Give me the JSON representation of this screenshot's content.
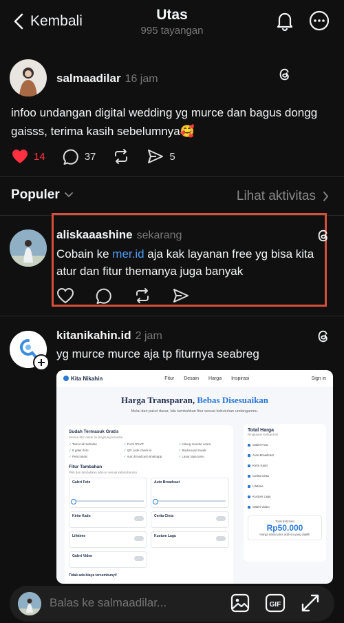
{
  "header": {
    "back_label": "Kembali",
    "title": "Utas",
    "subtitle": "995 tayangan"
  },
  "main_post": {
    "username": "salmaadilar",
    "time": "16 jam",
    "text": "infoo undangan digital  wedding yg murce dan bagus dongg gaisss, terima kasih sebelumnya🥰",
    "likes": "14",
    "comments": "37",
    "shares": "5"
  },
  "sort": {
    "label": "Populer",
    "activity_link": "Lihat aktivitas"
  },
  "reply1": {
    "username": "aliskaaashine",
    "time": "sekarang",
    "text_before": "Cobain ke ",
    "link": "mer.id",
    "text_after": " aja kak layanan free yg bisa kita atur dan fitur themanya juga banyak"
  },
  "reply2": {
    "username": "kitanikahin.id",
    "time": "2 jam",
    "text": "yg murce murce aja tp fiturnya seabreg"
  },
  "embedded": {
    "brand": "Kita Nikahin",
    "nav": [
      "Fitur",
      "Desain",
      "Harga",
      "Inspirasi"
    ],
    "sign_in": "Sign in",
    "headline_a": "Harga Transparan, ",
    "headline_b": "Bebas Disesuaikan",
    "sub": "Mulai dari paket dasar, lalu tambahkan fitur sesuai kebutuhan undanganmu.",
    "included_title": "Sudah Termasuk Gratis",
    "included_note": "Semua fitur dasar ini langsung tersedia",
    "included": [
      "Tamu tak terbatas",
      "Form RSVP",
      "Hitung mundur acara",
      "8 galeri foto",
      "QR code check-in",
      "Backsound musik",
      "Peta lokasi",
      "Auto broadcast whatsapp",
      "Layar tapa tamu"
    ],
    "addons_title": "Fitur Tambahan",
    "addons_note": "Pilih dan tambahkan add-on sesuai kebutuhanmu",
    "addons": [
      "Galeri Foto",
      "Auto Broadcast",
      "Kirim Kado",
      "Cerita Cinta",
      "Lifetime",
      "Kustom Lagu",
      "Galeri Video"
    ],
    "notice": "Tidak ada biaya tersembunyi!",
    "total_title": "Total Harga",
    "total_note": "Ringkasan Kebutuhan",
    "total_items": [
      "Galeri Foto",
      "Auto Broadcast",
      "Kirim Kado",
      "Cerita Cinta",
      "Lifetime",
      "Kustom Lagu",
      "Galeri Video"
    ],
    "estimate_label": "Total Estimasi",
    "estimate_price": "Rp50.000",
    "estimate_note": "Harga dasar plus add-on yang dipilih"
  },
  "reply_bar": {
    "placeholder": "Balas ke salmaadilar..."
  },
  "colors": {
    "background": "#101010",
    "like_red": "#ff3040",
    "link_blue": "#4d9cf5",
    "highlight_border": "#d64f3b"
  }
}
